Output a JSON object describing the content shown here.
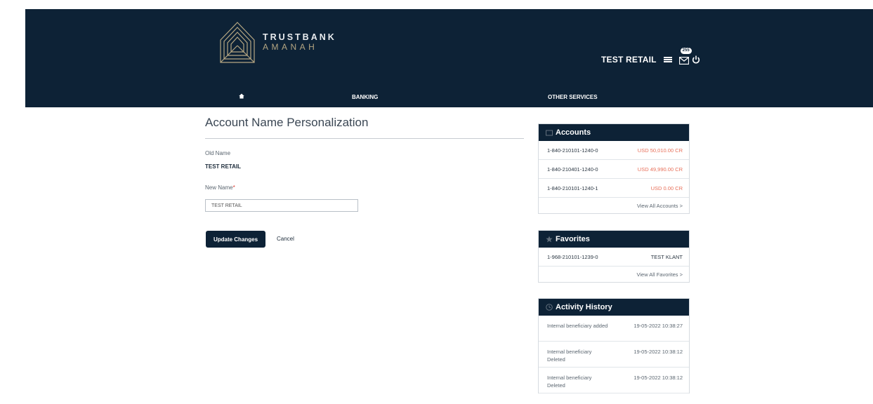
{
  "brand": {
    "line1": "TRUSTBANK",
    "line2": "AMANAH"
  },
  "header": {
    "user_name": "TEST RETAIL",
    "mail_count": "255"
  },
  "nav": {
    "banking": "BANKING",
    "other_services": "OTHER SERVICES"
  },
  "page": {
    "title": "Account Name Personalization",
    "old_name_label": "Old Name",
    "old_name_value": "TEST RETAIL",
    "new_name_label": "New Name",
    "required_mark": "*",
    "new_name_value": "TEST RETAIL",
    "update_button": "Update Changes",
    "cancel_button": "Cancel"
  },
  "accounts": {
    "title": "Accounts",
    "rows": [
      {
        "number": "1-840-210101-1240-0",
        "amount": "USD 50,010.00 CR"
      },
      {
        "number": "1-840-210401-1240-0",
        "amount": "USD 49,990.00 CR"
      },
      {
        "number": "1-840-210101-1240-1",
        "amount": "USD 0.00 CR"
      }
    ],
    "footer": "View All Accounts >"
  },
  "favorites": {
    "title": "Favorites",
    "rows": [
      {
        "number": "1-968-210101-1239-0",
        "name": "TEST KLANT"
      }
    ],
    "footer": "View All Favorites >"
  },
  "activity": {
    "title": "Activity History",
    "rows": [
      {
        "desc": "Internal beneficiary added",
        "time": "19-05-2022 10:38:27"
      },
      {
        "desc": "Internal beneficiary Deleted",
        "time": "19-05-2022 10:38:12"
      },
      {
        "desc": "Internal beneficiary Deleted",
        "time": "19-05-2022 10:38:12"
      }
    ]
  },
  "colors": {
    "navy": "#0d2236",
    "gold": "#b5a682",
    "amount": "#e8705a"
  }
}
